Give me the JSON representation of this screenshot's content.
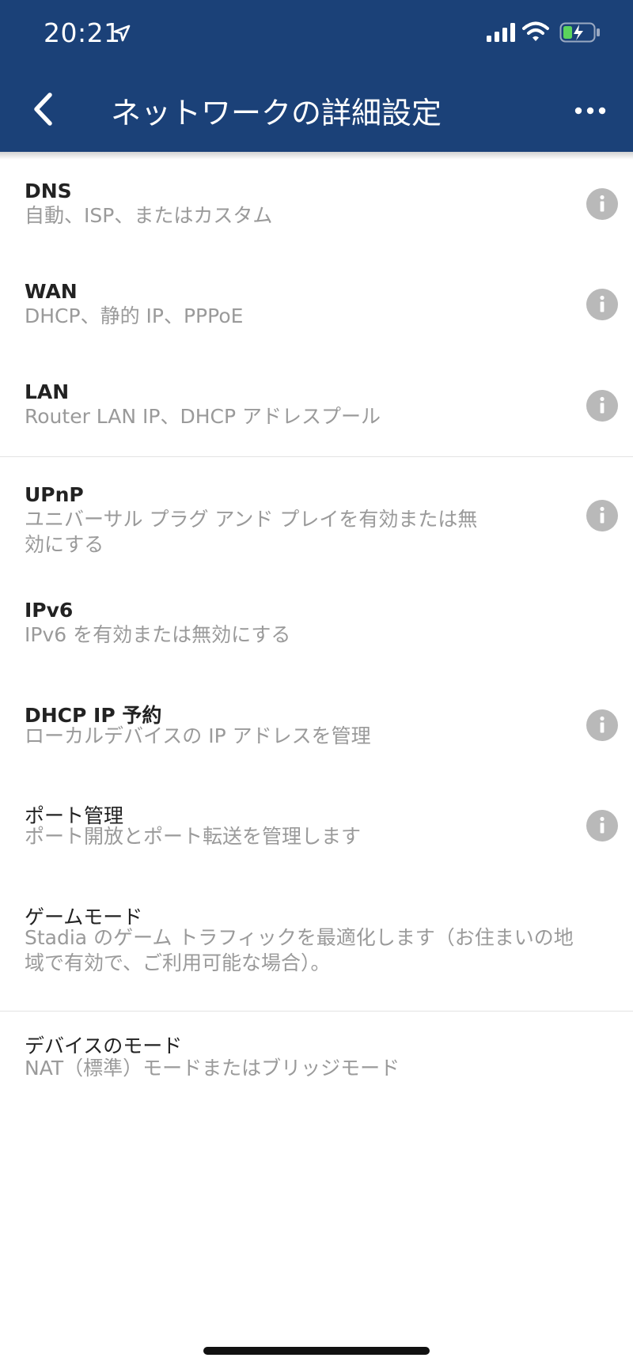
{
  "status_bar": {
    "time": "20:21"
  },
  "header": {
    "title": "ネットワークの詳細設定",
    "background": "#1b4178"
  },
  "icons": {
    "back": "chevron-left-icon",
    "more": "more-horizontal-icon",
    "info": "info-icon",
    "location": "location-arrow-icon",
    "signal": "cellular-signal-icon",
    "wifi": "wifi-icon",
    "battery": "battery-charging-icon"
  },
  "settings": {
    "dns": {
      "title": "DNS",
      "subtitle": "自動、ISP、またはカスタム"
    },
    "wan": {
      "title": "WAN",
      "subtitle": "DHCP、静的 IP、PPPoE"
    },
    "lan": {
      "title": "LAN",
      "subtitle": "Router LAN IP、DHCP アドレスプール"
    },
    "upnp": {
      "title": "UPnP",
      "subtitle_line1": "ユニバーサル プラグ アンド プレイを有効または無",
      "subtitle_line2": "効にする"
    },
    "ipv6": {
      "title": "IPv6",
      "subtitle": "IPv6 を有効または無効にする"
    },
    "dhcp_reservation": {
      "title": "DHCP IP 予約",
      "subtitle": "ローカルデバイスの IP アドレスを管理"
    },
    "port_management": {
      "title": "ポート管理",
      "subtitle": "ポート開放とポート転送を管理します"
    },
    "game_mode": {
      "title": "ゲームモード",
      "subtitle_line1": "Stadia のゲーム トラフィックを最適化します（お住まいの地",
      "subtitle_line2": "域で有効で、ご利用可能な場合）。"
    },
    "device_mode": {
      "title": "デバイスのモード",
      "subtitle": "NAT（標準）モードまたはブリッジモード"
    }
  }
}
